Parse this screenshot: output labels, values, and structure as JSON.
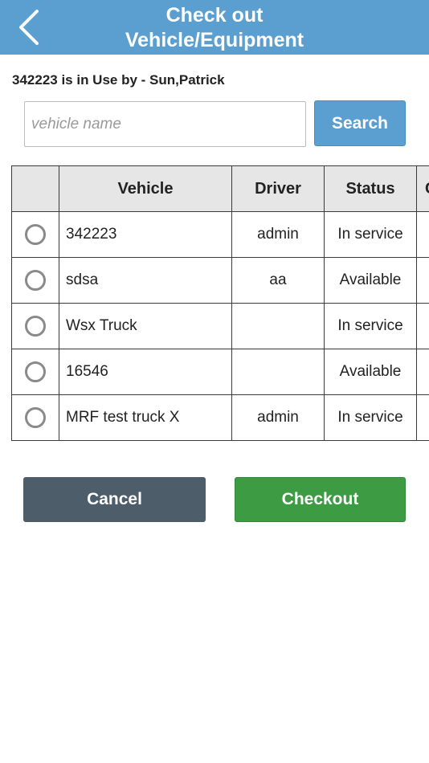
{
  "header": {
    "title_line1": "Check out",
    "title_line2": "Vehicle/Equipment",
    "back_icon": "chevron-left-icon",
    "color": "#5b9fd0"
  },
  "status_message": "342223 is in Use by - Sun,Patrick",
  "search": {
    "placeholder": "vehicle name",
    "value": "",
    "button_label": "Search"
  },
  "table": {
    "columns": [
      "",
      "Vehicle",
      "Driver",
      "Status",
      "C"
    ],
    "rows": [
      {
        "selected": false,
        "vehicle": "342223",
        "driver": "admin",
        "status": "In service"
      },
      {
        "selected": false,
        "vehicle": "sdsa",
        "driver": "aa",
        "status": "Available"
      },
      {
        "selected": false,
        "vehicle": "Wsx Truck",
        "driver": "",
        "status": "In service"
      },
      {
        "selected": false,
        "vehicle": "16546",
        "driver": "",
        "status": "Available"
      },
      {
        "selected": false,
        "vehicle": "MRF test truck X",
        "driver": "admin",
        "status": "In service"
      }
    ]
  },
  "actions": {
    "cancel_label": "Cancel",
    "checkout_label": "Checkout",
    "cancel_color": "#4e5d6a",
    "checkout_color": "#3d9b43"
  }
}
